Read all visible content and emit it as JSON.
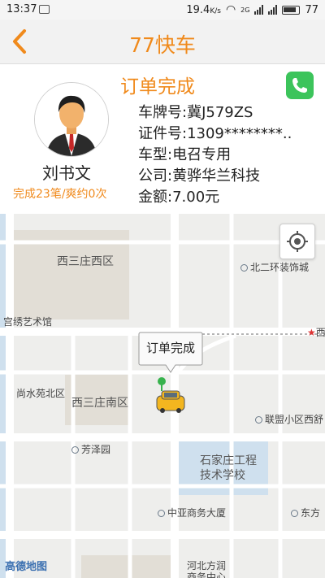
{
  "status_bar": {
    "time": "13:37",
    "speed": "19.4",
    "speed_unit": "K/s",
    "network": "2G",
    "battery": "77"
  },
  "header": {
    "title": "77快车"
  },
  "order": {
    "status": "订单完成",
    "driver": {
      "name": "刘书文",
      "stats": "完成23笔/爽约0次"
    },
    "plate": "车牌号:冀J579ZS",
    "license": "证件号:1309********..",
    "car_type": "车型:电召专用",
    "company": "公司:黄骅华兰科技",
    "amount": "金额:7.00元"
  },
  "map": {
    "callout": "订单完成",
    "logo": "高德地图",
    "labels": {
      "xisanzhuang_west": "西三庄西区",
      "beierhuan": "北二环装饰城",
      "gongyi": "宫绣艺术馆",
      "xi": "西",
      "shangshuiyuan": "尚水苑北区",
      "xisanzhuang_south": "西三庄南区",
      "lianmeng": "联盟小区西舒",
      "fangze": "芳泽园",
      "school_line1": "石家庄工程",
      "school_line2": "技术学校",
      "zhongya": "中亚商务大厦",
      "dongfang": "东方",
      "hebei_line1": "河北方润",
      "hebei_line2": "商务中心"
    },
    "colors": {
      "accent": "#f08a1c",
      "phone": "#3cc45b",
      "water": "#cfe0ee"
    }
  }
}
